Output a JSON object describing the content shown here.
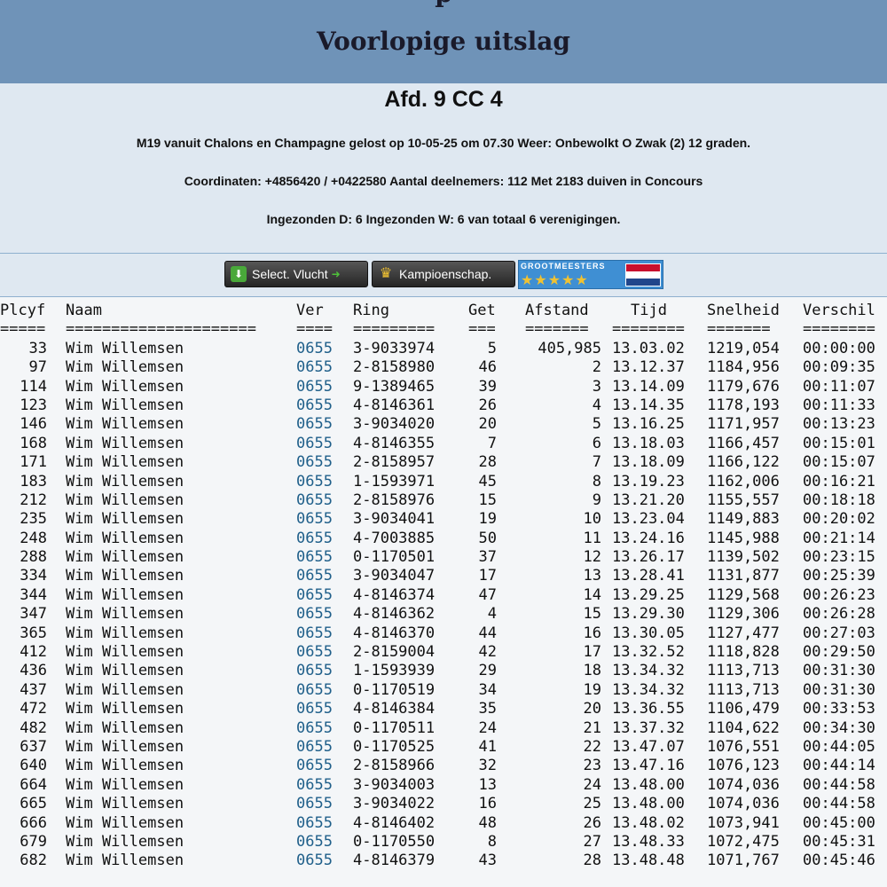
{
  "header": {
    "cut_text": "p",
    "title": "Voorlopige uitslag"
  },
  "info": {
    "afdeling": "Afd. 9 CC 4",
    "line1": "M19 vanuit Chalons en Champagne gelost op 10-05-25 om 07.30 Weer: Onbewolkt O Zwak (2) 12 graden.",
    "line2": "Coordinaten: +4856420 / +0422580 Aantal deelnemers: 112 Met 2183 duiven in Concours",
    "line3": "Ingezonden D: 6 Ingezonden W: 6 van totaal 6 verenigingen."
  },
  "buttons": {
    "select_vlucht": "Select. Vlucht",
    "kampioenschap": "Kampioenschap.",
    "grootmeesters": "GROOTMEESTERS",
    "stars": "★★★★★"
  },
  "colors": {
    "header_bg": "#6f93b8",
    "info_bg": "#dfe8f1",
    "link": "#1f5f8a"
  },
  "table": {
    "headers": {
      "plcyf": "Plcyf",
      "naam": "Naam",
      "ver": "Ver",
      "ring": "Ring",
      "get": "Get",
      "afstand": "Afstand",
      "tijd": "Tijd",
      "snelheid": "Snelheid",
      "verschil": "Verschil"
    },
    "separators": {
      "plcyf": "=====",
      "naam": "=====================",
      "ver": "====",
      "ring": "=========",
      "get": "===",
      "afstand": "=======",
      "tijd": "========",
      "snelheid": "=======",
      "verschil": "========"
    },
    "rows": [
      {
        "plc": "33",
        "naam": "Wim Willemsen",
        "ver": "0655",
        "ring": "3-9033974",
        "get": "5",
        "afstand": "405,985",
        "tijd": "13.03.02",
        "snelheid": "1219,054",
        "verschil": "00:00:00"
      },
      {
        "plc": "97",
        "naam": "Wim Willemsen",
        "ver": "0655",
        "ring": "2-8158980",
        "get": "46",
        "afstand": "2",
        "tijd": "13.12.37",
        "snelheid": "1184,956",
        "verschil": "00:09:35"
      },
      {
        "plc": "114",
        "naam": "Wim Willemsen",
        "ver": "0655",
        "ring": "9-1389465",
        "get": "39",
        "afstand": "3",
        "tijd": "13.14.09",
        "snelheid": "1179,676",
        "verschil": "00:11:07"
      },
      {
        "plc": "123",
        "naam": "Wim Willemsen",
        "ver": "0655",
        "ring": "4-8146361",
        "get": "26",
        "afstand": "4",
        "tijd": "13.14.35",
        "snelheid": "1178,193",
        "verschil": "00:11:33"
      },
      {
        "plc": "146",
        "naam": "Wim Willemsen",
        "ver": "0655",
        "ring": "3-9034020",
        "get": "20",
        "afstand": "5",
        "tijd": "13.16.25",
        "snelheid": "1171,957",
        "verschil": "00:13:23"
      },
      {
        "plc": "168",
        "naam": "Wim Willemsen",
        "ver": "0655",
        "ring": "4-8146355",
        "get": "7",
        "afstand": "6",
        "tijd": "13.18.03",
        "snelheid": "1166,457",
        "verschil": "00:15:01"
      },
      {
        "plc": "171",
        "naam": "Wim Willemsen",
        "ver": "0655",
        "ring": "2-8158957",
        "get": "28",
        "afstand": "7",
        "tijd": "13.18.09",
        "snelheid": "1166,122",
        "verschil": "00:15:07"
      },
      {
        "plc": "183",
        "naam": "Wim Willemsen",
        "ver": "0655",
        "ring": "1-1593971",
        "get": "45",
        "afstand": "8",
        "tijd": "13.19.23",
        "snelheid": "1162,006",
        "verschil": "00:16:21"
      },
      {
        "plc": "212",
        "naam": "Wim Willemsen",
        "ver": "0655",
        "ring": "2-8158976",
        "get": "15",
        "afstand": "9",
        "tijd": "13.21.20",
        "snelheid": "1155,557",
        "verschil": "00:18:18"
      },
      {
        "plc": "235",
        "naam": "Wim Willemsen",
        "ver": "0655",
        "ring": "3-9034041",
        "get": "19",
        "afstand": "10",
        "tijd": "13.23.04",
        "snelheid": "1149,883",
        "verschil": "00:20:02"
      },
      {
        "plc": "248",
        "naam": "Wim Willemsen",
        "ver": "0655",
        "ring": "4-7003885",
        "get": "50",
        "afstand": "11",
        "tijd": "13.24.16",
        "snelheid": "1145,988",
        "verschil": "00:21:14"
      },
      {
        "plc": "288",
        "naam": "Wim Willemsen",
        "ver": "0655",
        "ring": "0-1170501",
        "get": "37",
        "afstand": "12",
        "tijd": "13.26.17",
        "snelheid": "1139,502",
        "verschil": "00:23:15"
      },
      {
        "plc": "334",
        "naam": "Wim Willemsen",
        "ver": "0655",
        "ring": "3-9034047",
        "get": "17",
        "afstand": "13",
        "tijd": "13.28.41",
        "snelheid": "1131,877",
        "verschil": "00:25:39"
      },
      {
        "plc": "344",
        "naam": "Wim Willemsen",
        "ver": "0655",
        "ring": "4-8146374",
        "get": "47",
        "afstand": "14",
        "tijd": "13.29.25",
        "snelheid": "1129,568",
        "verschil": "00:26:23"
      },
      {
        "plc": "347",
        "naam": "Wim Willemsen",
        "ver": "0655",
        "ring": "4-8146362",
        "get": "4",
        "afstand": "15",
        "tijd": "13.29.30",
        "snelheid": "1129,306",
        "verschil": "00:26:28"
      },
      {
        "plc": "365",
        "naam": "Wim Willemsen",
        "ver": "0655",
        "ring": "4-8146370",
        "get": "44",
        "afstand": "16",
        "tijd": "13.30.05",
        "snelheid": "1127,477",
        "verschil": "00:27:03"
      },
      {
        "plc": "412",
        "naam": "Wim Willemsen",
        "ver": "0655",
        "ring": "2-8159004",
        "get": "42",
        "afstand": "17",
        "tijd": "13.32.52",
        "snelheid": "1118,828",
        "verschil": "00:29:50"
      },
      {
        "plc": "436",
        "naam": "Wim Willemsen",
        "ver": "0655",
        "ring": "1-1593939",
        "get": "29",
        "afstand": "18",
        "tijd": "13.34.32",
        "snelheid": "1113,713",
        "verschil": "00:31:30"
      },
      {
        "plc": "437",
        "naam": "Wim Willemsen",
        "ver": "0655",
        "ring": "0-1170519",
        "get": "34",
        "afstand": "19",
        "tijd": "13.34.32",
        "snelheid": "1113,713",
        "verschil": "00:31:30"
      },
      {
        "plc": "472",
        "naam": "Wim Willemsen",
        "ver": "0655",
        "ring": "4-8146384",
        "get": "35",
        "afstand": "20",
        "tijd": "13.36.55",
        "snelheid": "1106,479",
        "verschil": "00:33:53"
      },
      {
        "plc": "482",
        "naam": "Wim Willemsen",
        "ver": "0655",
        "ring": "0-1170511",
        "get": "24",
        "afstand": "21",
        "tijd": "13.37.32",
        "snelheid": "1104,622",
        "verschil": "00:34:30"
      },
      {
        "plc": "637",
        "naam": "Wim Willemsen",
        "ver": "0655",
        "ring": "0-1170525",
        "get": "41",
        "afstand": "22",
        "tijd": "13.47.07",
        "snelheid": "1076,551",
        "verschil": "00:44:05"
      },
      {
        "plc": "640",
        "naam": "Wim Willemsen",
        "ver": "0655",
        "ring": "2-8158966",
        "get": "32",
        "afstand": "23",
        "tijd": "13.47.16",
        "snelheid": "1076,123",
        "verschil": "00:44:14"
      },
      {
        "plc": "664",
        "naam": "Wim Willemsen",
        "ver": "0655",
        "ring": "3-9034003",
        "get": "13",
        "afstand": "24",
        "tijd": "13.48.00",
        "snelheid": "1074,036",
        "verschil": "00:44:58"
      },
      {
        "plc": "665",
        "naam": "Wim Willemsen",
        "ver": "0655",
        "ring": "3-9034022",
        "get": "16",
        "afstand": "25",
        "tijd": "13.48.00",
        "snelheid": "1074,036",
        "verschil": "00:44:58"
      },
      {
        "plc": "666",
        "naam": "Wim Willemsen",
        "ver": "0655",
        "ring": "4-8146402",
        "get": "48",
        "afstand": "26",
        "tijd": "13.48.02",
        "snelheid": "1073,941",
        "verschil": "00:45:00"
      },
      {
        "plc": "679",
        "naam": "Wim Willemsen",
        "ver": "0655",
        "ring": "0-1170550",
        "get": "8",
        "afstand": "27",
        "tijd": "13.48.33",
        "snelheid": "1072,475",
        "verschil": "00:45:31"
      },
      {
        "plc": "682",
        "naam": "Wim Willemsen",
        "ver": "0655",
        "ring": "4-8146379",
        "get": "43",
        "afstand": "28",
        "tijd": "13.48.48",
        "snelheid": "1071,767",
        "verschil": "00:45:46"
      }
    ]
  }
}
